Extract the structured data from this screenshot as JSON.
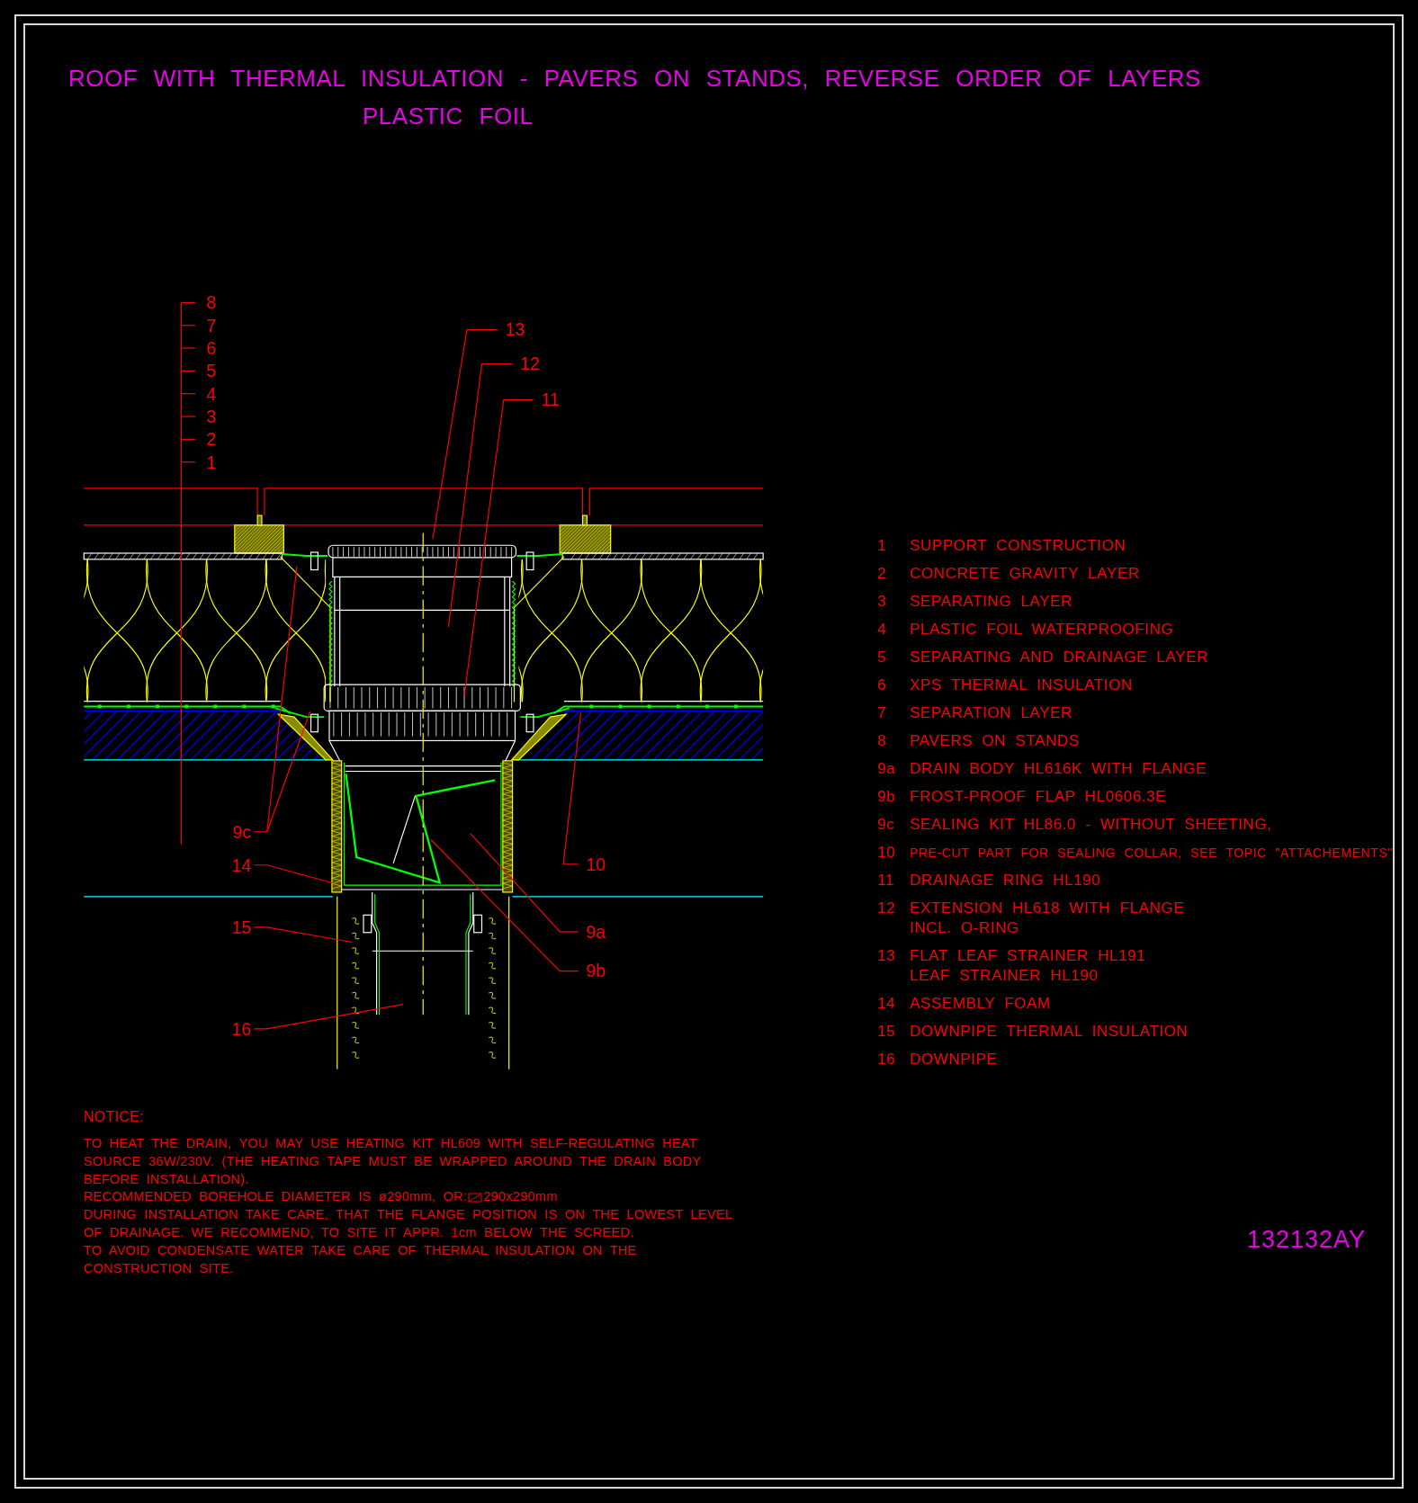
{
  "title": {
    "line_1": "ROOF WITH THERMAL INSULATION - PAVERS ON STANDS, REVERSE ORDER OF LAYERS",
    "line_2": "PLASTIC FOIL"
  },
  "drawing": {
    "layer_numbers": [
      "8",
      "7",
      "6",
      "5",
      "4",
      "3",
      "2",
      "1"
    ],
    "callouts": [
      "13",
      "12",
      "11",
      "9c",
      "14",
      "15",
      "16",
      "10",
      "9a",
      "9b"
    ]
  },
  "legend": [
    {
      "number": "1",
      "lines": [
        "SUPPORT CONSTRUCTION"
      ]
    },
    {
      "number": "2",
      "lines": [
        "CONCRETE GRAVITY LAYER"
      ]
    },
    {
      "number": "3",
      "lines": [
        "SEPARATING LAYER"
      ]
    },
    {
      "number": "4",
      "lines": [
        "PLASTIC FOIL WATERPROOFING"
      ]
    },
    {
      "number": "5",
      "lines": [
        "SEPARATING AND DRAINAGE LAYER"
      ]
    },
    {
      "number": "6",
      "lines": [
        "XPS THERMAL INSULATION"
      ]
    },
    {
      "number": "7",
      "lines": [
        "SEPARATION LAYER"
      ]
    },
    {
      "number": "8",
      "lines": [
        "PAVERS ON STANDS"
      ]
    },
    {
      "number": "9a",
      "lines": [
        "DRAIN BODY HL616K WITH FLANGE"
      ]
    },
    {
      "number": "9b",
      "lines": [
        "FROST-PROOF FLAP HL0606.3E"
      ]
    },
    {
      "number": "9c",
      "lines": [
        "SEALING KIT HL86.0 - WITHOUT SHEETING,"
      ]
    },
    {
      "number": "10",
      "lines": [
        "PRE-CUT PART FOR SEALING COLLAR, SEE TOPIC \"ATTACHEMENTS\""
      ]
    },
    {
      "number": "11",
      "lines": [
        "DRAINAGE RING HL190"
      ]
    },
    {
      "number": "12",
      "lines": [
        "EXTENSION HL618 WITH FLANGE",
        "INCL. O-RING"
      ]
    },
    {
      "number": "13",
      "lines": [
        "FLAT LEAF STRAINER HL191",
        "LEAF STRAINER HL190"
      ]
    },
    {
      "number": "14",
      "lines": [
        "ASSEMBLY FOAM"
      ]
    },
    {
      "number": "15",
      "lines": [
        "DOWNPIPE THERMAL INSULATION"
      ]
    },
    {
      "number": "16",
      "lines": [
        "DOWNPIPE"
      ]
    }
  ],
  "notice": {
    "heading": "NOTICE:",
    "lines": [
      {
        "kind": "text",
        "text": "TO HEAT THE DRAIN, YOU MAY USE HEATING KIT HL609 WITH SELF-REGULATING HEAT"
      },
      {
        "kind": "text",
        "text": "SOURCE 36W/230V. (THE HEATING TAPE MUST BE WRAPPED AROUND THE DRAIN BODY"
      },
      {
        "kind": "text",
        "text": "BEFORE INSTALLATION)."
      },
      {
        "kind": "square",
        "text": "RECOMMENDED BOREHOLE DIAMETER IS ø290mm, OR:",
        "after": "290x290mm"
      },
      {
        "kind": "text",
        "text": "DURING INSTALLATION TAKE CARE, THAT THE FLANGE POSITION IS ON THE LOWEST LEVEL"
      },
      {
        "kind": "text",
        "text": "OF DRAINAGE. WE RECOMMEND, TO SITE IT APPR. 1cm BELOW THE SCREED."
      },
      {
        "kind": "text",
        "text": "TO AVOID CONDENSATE WATER TAKE CARE OF THERMAL INSULATION ON THE"
      },
      {
        "kind": "text",
        "text": "CONSTRUCTION SITE."
      }
    ]
  },
  "drawing_number": "132132AY"
}
